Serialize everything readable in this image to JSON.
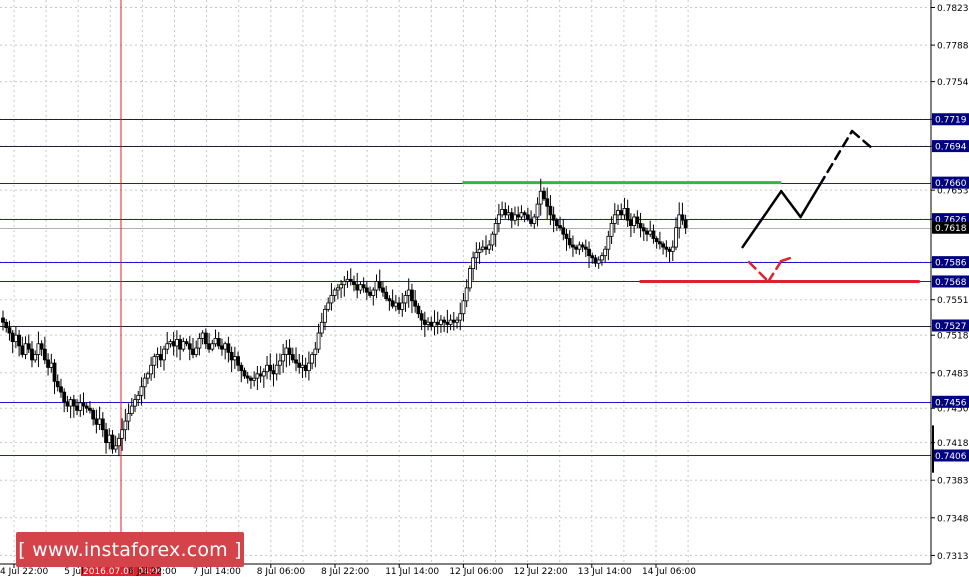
{
  "colors": {
    "background": "#ffffff",
    "grid": "#c8c8c8",
    "axis": "#000000",
    "level_line": "#1a1acc",
    "resistance": "#2fb84a",
    "support": "#e0202a",
    "price_label_bg": "#000080",
    "date_marker": "#e0202a",
    "candle": "#000000",
    "logo_bg": "#d4434a",
    "arrow_bull": "#000000",
    "arrow_bear": "#e0202a"
  },
  "logo": {
    "text": "[ www.instaforex.com ]"
  },
  "chart_data": {
    "type": "candlestick",
    "ylim": [
      0.7305,
      0.783
    ],
    "y_tick_labels": [
      "0.7823",
      "0.7788",
      "0.7754",
      "0.7719",
      "0.7694",
      "0.7653",
      "0.7626",
      "0.7586",
      "0.7551",
      "0.7518",
      "0.7483",
      "0.7450",
      "0.7418",
      "0.7383",
      "0.7348",
      "0.7313"
    ],
    "x_tick_labels": [
      "4 Jul 22:00",
      "5 Jul",
      "6 Jul 22:00",
      "7 Jul 14:00",
      "8 Jul 06:00",
      "8 Jul 22:00",
      "11 Jul 14:00",
      "12 Jul 06:00",
      "12 Jul 22:00",
      "13 Jul 14:00",
      "14 Jul 06:00"
    ],
    "date_marker_label": "2016.07.06 04:00",
    "levels": [
      {
        "label": "0.7719",
        "value": 0.7719,
        "kind": "level"
      },
      {
        "label": "0.7694",
        "value": 0.7694,
        "kind": "level"
      },
      {
        "label": "0.7660",
        "value": 0.766,
        "kind": "level"
      },
      {
        "label": "0.7626",
        "value": 0.7626,
        "kind": "level"
      },
      {
        "label": "0.7618",
        "value": 0.7618,
        "kind": "current"
      },
      {
        "label": "0.7586",
        "value": 0.7586,
        "kind": "level"
      },
      {
        "label": "0.7568",
        "value": 0.7568,
        "kind": "level"
      },
      {
        "label": "0.7527",
        "value": 0.7527,
        "kind": "level"
      },
      {
        "label": "0.7456",
        "value": 0.7456,
        "kind": "level"
      },
      {
        "label": "0.7406",
        "value": 0.7406,
        "kind": "level"
      }
    ],
    "resistance_line": {
      "value": 0.766,
      "from_bar": 143,
      "to_bar": 242
    },
    "support_line": {
      "value": 0.7568,
      "from_bar": 198,
      "to_bar": 285
    },
    "closes": [
      0.753,
      0.7525,
      0.752,
      0.7512,
      0.7518,
      0.7508,
      0.75,
      0.751,
      0.7505,
      0.7495,
      0.75,
      0.751,
      0.7505,
      0.7495,
      0.7488,
      0.7492,
      0.7475,
      0.747,
      0.7465,
      0.7456,
      0.7452,
      0.7458,
      0.7452,
      0.7448,
      0.7455,
      0.7452,
      0.745,
      0.7448,
      0.744,
      0.7435,
      0.744,
      0.743,
      0.7418,
      0.7425,
      0.7412,
      0.7415,
      0.7422,
      0.743,
      0.7438,
      0.7445,
      0.7452,
      0.7458,
      0.7462,
      0.747,
      0.7478,
      0.7482,
      0.749,
      0.7498,
      0.75,
      0.7495,
      0.7505,
      0.751,
      0.7512,
      0.7508,
      0.7514,
      0.7505,
      0.7512,
      0.751,
      0.7505,
      0.75,
      0.7506,
      0.7515,
      0.752,
      0.751,
      0.7505,
      0.751,
      0.7515,
      0.7508,
      0.7505,
      0.751,
      0.7502,
      0.7495,
      0.7498,
      0.749,
      0.7485,
      0.748,
      0.7478,
      0.7476,
      0.7478,
      0.7482,
      0.748,
      0.7484,
      0.749,
      0.7485,
      0.7482,
      0.749,
      0.7494,
      0.75,
      0.7506,
      0.75,
      0.7495,
      0.7492,
      0.7488,
      0.749,
      0.7485,
      0.7492,
      0.75,
      0.7505,
      0.752,
      0.753,
      0.7542,
      0.7548,
      0.7555,
      0.756,
      0.7562,
      0.7565,
      0.7568,
      0.757,
      0.7568,
      0.7565,
      0.756,
      0.7565,
      0.7562,
      0.7558,
      0.7555,
      0.756,
      0.7568,
      0.7562,
      0.7558,
      0.7552,
      0.755,
      0.7545,
      0.7548,
      0.7542,
      0.7548,
      0.7555,
      0.756,
      0.755,
      0.7545,
      0.7538,
      0.7532,
      0.7528,
      0.753,
      0.7526,
      0.753,
      0.7528,
      0.7532,
      0.753,
      0.7528,
      0.7532,
      0.753,
      0.7532,
      0.7538,
      0.755,
      0.7562,
      0.758,
      0.759,
      0.7595,
      0.7598,
      0.76,
      0.7598,
      0.7602,
      0.7612,
      0.7622,
      0.763,
      0.7635,
      0.763,
      0.7632,
      0.7625,
      0.763,
      0.7628,
      0.7632,
      0.763,
      0.7626,
      0.7622,
      0.7628,
      0.764,
      0.7652,
      0.7645,
      0.7638,
      0.763,
      0.7625,
      0.762,
      0.7618,
      0.7612,
      0.7608,
      0.7602,
      0.76,
      0.7598,
      0.7602,
      0.76,
      0.7598,
      0.7592,
      0.759,
      0.7585,
      0.7588,
      0.7592,
      0.7598,
      0.761,
      0.7622,
      0.763,
      0.7634,
      0.763,
      0.7636,
      0.7625,
      0.762,
      0.7628,
      0.7622,
      0.7618,
      0.7615,
      0.7612,
      0.7615,
      0.7608,
      0.7605,
      0.7603,
      0.76,
      0.7598,
      0.7596,
      0.76,
      0.7618,
      0.763,
      0.7625,
      0.7618
    ],
    "forecast_bull": [
      [
        230,
        0.76
      ],
      [
        242,
        0.7652
      ],
      [
        248,
        0.7628
      ],
      [
        254,
        0.7658
      ],
      [
        264,
        0.7708
      ],
      [
        271,
        0.769
      ]
    ],
    "forecast_bear": [
      [
        232,
        0.7586
      ],
      [
        238,
        0.7568
      ],
      [
        242,
        0.7587
      ],
      [
        245,
        0.759
      ]
    ]
  }
}
